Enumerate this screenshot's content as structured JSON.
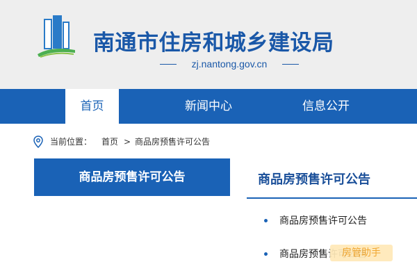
{
  "header": {
    "title": "南通市住房和城乡建设局",
    "domain": "zj.nantong.gov.cn",
    "logo_icon": "city-buildings-logo-icon"
  },
  "nav": {
    "items": [
      {
        "label": "首页",
        "active": true
      },
      {
        "label": "新闻中心",
        "active": false
      },
      {
        "label": "信息公开",
        "active": false
      }
    ]
  },
  "breadcrumb": {
    "icon": "location-pin-icon",
    "label": "当前位置：",
    "home": "首页",
    "separator": ">",
    "current": "商品房预售许可公告"
  },
  "sidebar": {
    "title": "商品房预售许可公告"
  },
  "content": {
    "title": "商品房预售许可公告",
    "items": [
      {
        "label": "商品房预售许可公告"
      },
      {
        "label": "商品房预售许可公告"
      }
    ]
  },
  "watermark": {
    "text": "房管助手"
  },
  "colors": {
    "primary": "#1a62b6",
    "title_blue": "#1a58a8",
    "header_bg": "#eeeeee"
  }
}
